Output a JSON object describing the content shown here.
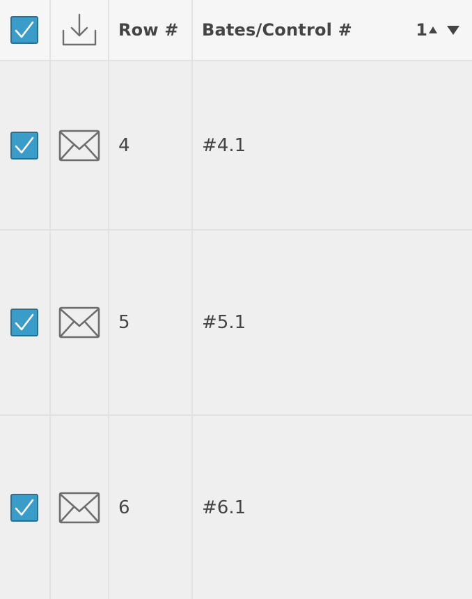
{
  "header": {
    "row_label": "Row #",
    "bates_label": "Bates/Control #",
    "sort_order": "1",
    "select_all_checked": true
  },
  "rows": [
    {
      "row_number": "4",
      "bates": "#4.1",
      "checked": true
    },
    {
      "row_number": "5",
      "bates": "#5.1",
      "checked": true
    },
    {
      "row_number": "6",
      "bates": "#6.1",
      "checked": true
    }
  ],
  "icons": {
    "header_download": "download-icon",
    "row_type": "envelope-icon",
    "sort_up": "triangle-up-icon",
    "sort_down": "triangle-down-icon",
    "check": "checkmark-icon"
  },
  "colors": {
    "checkbox_fill": "#3a9cc8",
    "checkbox_border": "#2b6e8f",
    "header_bg": "#f6f6f6",
    "row_bg": "#efefef",
    "grid_line": "#e2e2e2",
    "icon_gray": "#6d6d6d",
    "text": "#444444"
  }
}
